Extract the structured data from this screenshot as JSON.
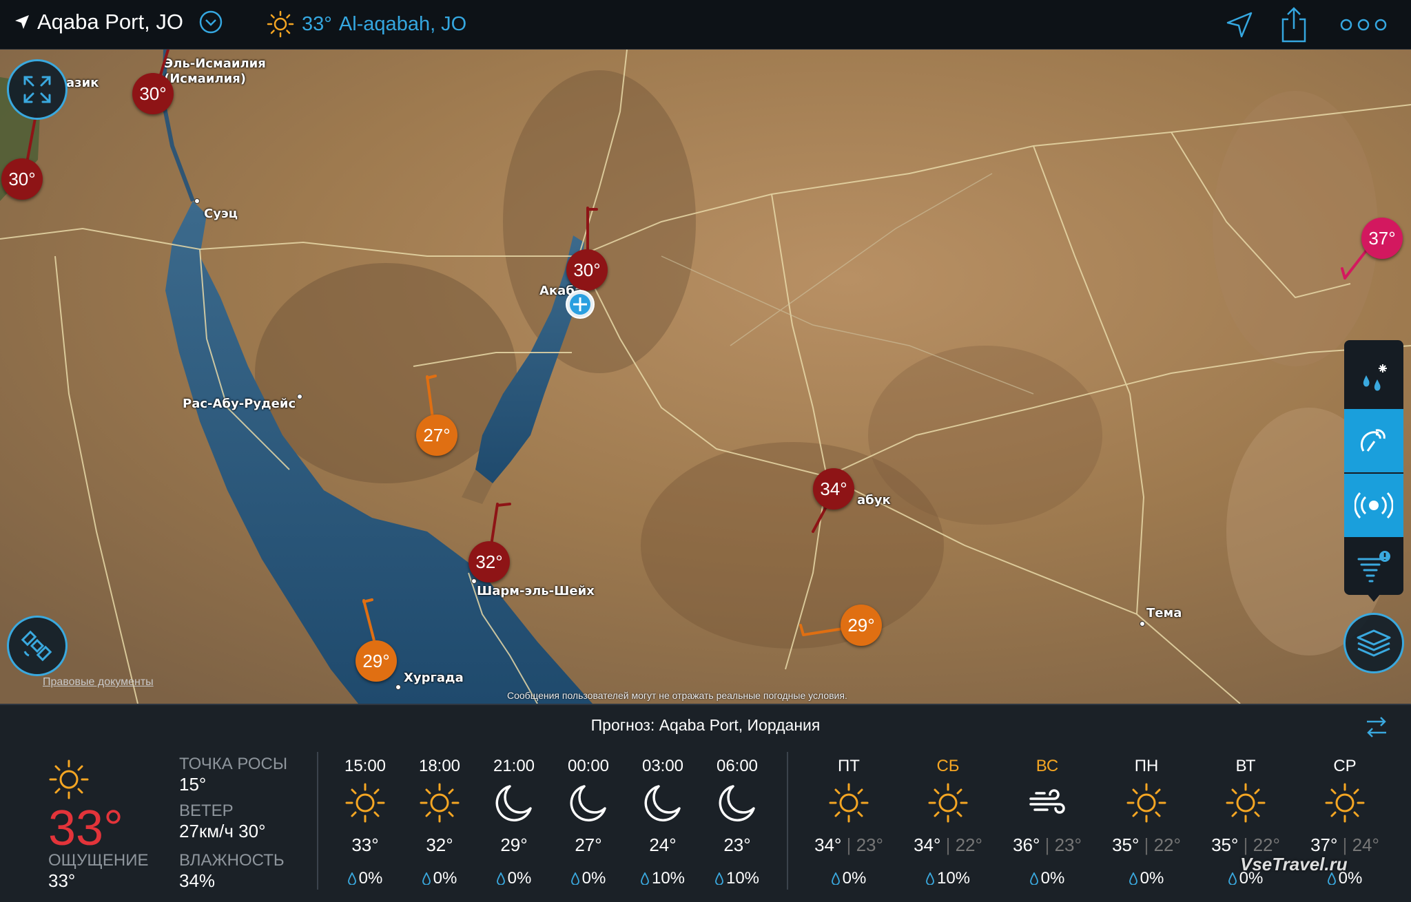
{
  "header": {
    "location": "Aqaba Port, JO",
    "current_temp": "33°",
    "current_place": "Al-aqabah, JO"
  },
  "map": {
    "cities": [
      {
        "name": "Эль-Исмаилия",
        "id": "ismailia-1"
      },
      {
        "name": "(Исмаилия)",
        "id": "ismailia-2"
      },
      {
        "name": "азик",
        "id": "zagazig"
      },
      {
        "name": "Суэц",
        "id": "suez"
      },
      {
        "name": "Акаба",
        "id": "aqaba"
      },
      {
        "name": "Рас-Абу-Рудейс",
        "id": "ras-abu-rudeis"
      },
      {
        "name": "Шарм-эль-Шейх",
        "id": "sharm"
      },
      {
        "name": "Хургада",
        "id": "hurghada"
      },
      {
        "name": "абук",
        "id": "tabuk"
      },
      {
        "name": "Тема",
        "id": "tema"
      }
    ],
    "pins": [
      {
        "temp": "30°",
        "color": "red"
      },
      {
        "temp": "30°",
        "color": "red"
      },
      {
        "temp": "30°",
        "color": "red"
      },
      {
        "temp": "27°",
        "color": "orange"
      },
      {
        "temp": "32°",
        "color": "red"
      },
      {
        "temp": "29°",
        "color": "orange"
      },
      {
        "temp": "34°",
        "color": "red"
      },
      {
        "temp": "29°",
        "color": "orange"
      },
      {
        "temp": "37°",
        "color": "pink"
      }
    ],
    "legal_link": "Правовые документы",
    "disclaimer": "Сообщения пользователей могут не отражать реальные погодные условия."
  },
  "forecast": {
    "title": "Прогноз: Aqaba Port, Иордания",
    "now": {
      "temp": "33°",
      "feels_label": "ОЩУЩЕНИЕ",
      "feels_value": "33°",
      "dew_label": "ТОЧКА РОСЫ",
      "dew_value": "15°",
      "wind_label": "ВЕТЕР",
      "wind_value": "27км/ч 30°",
      "humidity_label": "ВЛАЖНОСТЬ",
      "humidity_value": "34%"
    },
    "hourly": [
      {
        "time": "15:00",
        "icon": "sun",
        "temp": "33°",
        "rain": "0%"
      },
      {
        "time": "18:00",
        "icon": "sun",
        "temp": "32°",
        "rain": "0%"
      },
      {
        "time": "21:00",
        "icon": "moon",
        "temp": "29°",
        "rain": "0%"
      },
      {
        "time": "00:00",
        "icon": "moon",
        "temp": "27°",
        "rain": "0%"
      },
      {
        "time": "03:00",
        "icon": "moon",
        "temp": "24°",
        "rain": "10%"
      },
      {
        "time": "06:00",
        "icon": "moon",
        "temp": "23°",
        "rain": "10%"
      }
    ],
    "daily": [
      {
        "day": "ПТ",
        "weekend": false,
        "icon": "sun",
        "hi": "34°",
        "lo": "23°",
        "rain": "0%"
      },
      {
        "day": "СБ",
        "weekend": true,
        "icon": "sun",
        "hi": "34°",
        "lo": "22°",
        "rain": "10%"
      },
      {
        "day": "ВС",
        "weekend": true,
        "icon": "wind",
        "hi": "36°",
        "lo": "23°",
        "rain": "0%"
      },
      {
        "day": "ПН",
        "weekend": false,
        "icon": "sun",
        "hi": "35°",
        "lo": "22°",
        "rain": "0%"
      },
      {
        "day": "ВТ",
        "weekend": false,
        "icon": "sun",
        "hi": "35°",
        "lo": "22°",
        "rain": "0%"
      },
      {
        "day": "СР",
        "weekend": false,
        "icon": "sun",
        "hi": "37°",
        "lo": "24°",
        "rain": "0%"
      }
    ]
  },
  "watermark": "VseTravel.ru",
  "colors": {
    "accent": "#35a7e0",
    "sun": "#f5a623",
    "current_temp": "#e3343a",
    "pin_red": "#8e1416",
    "pin_orange": "#e06f12",
    "pin_pink": "#d3185f"
  }
}
